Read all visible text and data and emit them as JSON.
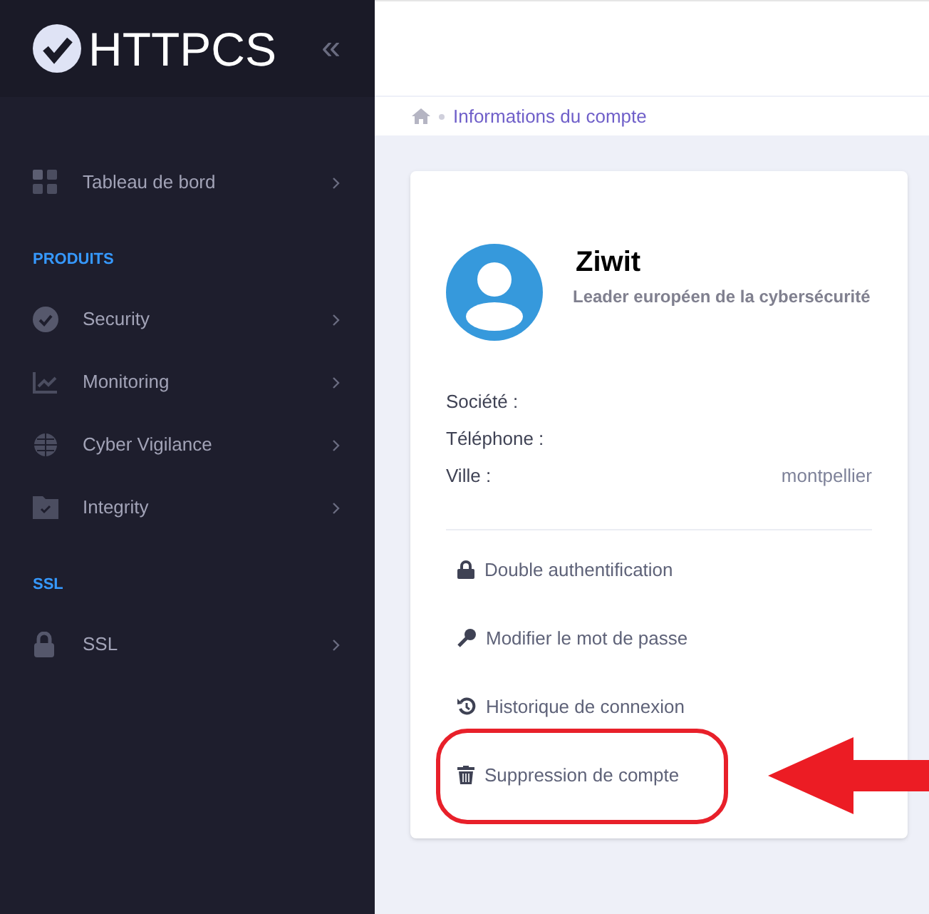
{
  "sidebar": {
    "logo": "HTTPCS",
    "collapse": "«",
    "groups": [
      {
        "items": [
          {
            "label": "Tableau de bord",
            "kind": "dashboard"
          }
        ]
      },
      {
        "heading": "PRODUITS",
        "items": [
          {
            "label": "Security",
            "kind": "check"
          },
          {
            "label": "Monitoring",
            "kind": "chart"
          },
          {
            "label": "Cyber Vigilance",
            "kind": "globe"
          },
          {
            "label": "Integrity",
            "kind": "folder"
          }
        ]
      },
      {
        "heading": "SSL",
        "items": [
          {
            "label": "SSL",
            "kind": "lock"
          }
        ]
      }
    ]
  },
  "breadcrumb": {
    "current": "Informations du compte"
  },
  "profile": {
    "name": "Ziwit",
    "tagline": "Leader européen de la cybersécurité",
    "fields": [
      {
        "label": "Société :"
      },
      {
        "label": "Téléphone :"
      },
      {
        "label": "Ville :",
        "value": "montpellier"
      }
    ],
    "actions": [
      {
        "label": "Double authentification",
        "kind": "lock"
      },
      {
        "label": "Modifier le mot de passe",
        "kind": "key"
      },
      {
        "label": "Historique de connexion",
        "kind": "history"
      },
      {
        "label": "Suppression de compte",
        "kind": "trash",
        "highlighted": true
      }
    ]
  }
}
